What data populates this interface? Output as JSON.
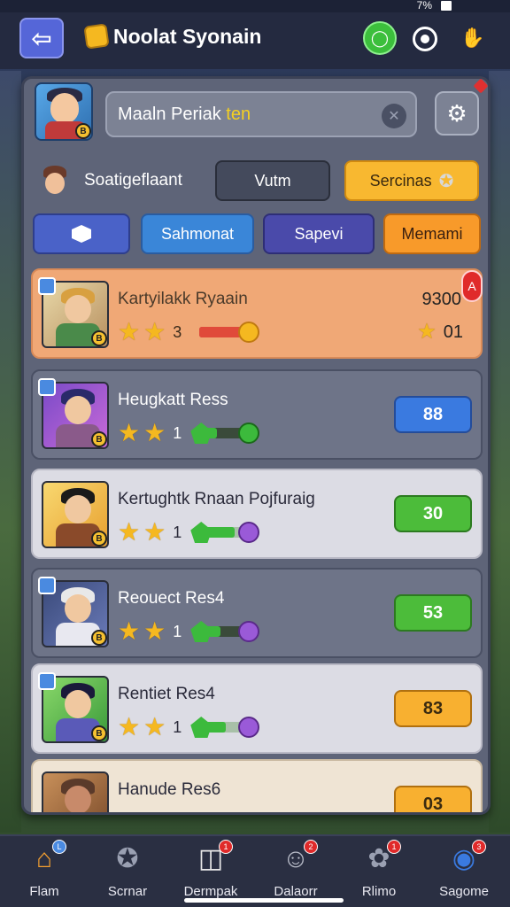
{
  "status_bar": {
    "battery_text": "7%"
  },
  "header": {
    "title": "Noolat Syonain",
    "back_icon": "back-arrow-icon",
    "chat_icon": "chat-icon",
    "record_icon": "record-icon",
    "hand_icon": "hand-icon"
  },
  "search": {
    "value_prefix": "Maaln Periak",
    "value_highlight": "ten",
    "clear_icon": "clear-icon"
  },
  "profile": {
    "name": "Soatigeflaant"
  },
  "buttons_row1": {
    "vutm": "Vutm",
    "sercinas": "Sercinas"
  },
  "filters": [
    {
      "label": "",
      "icon": "cube-icon"
    },
    {
      "label": "Sahmonat"
    },
    {
      "label": "Sapevi"
    },
    {
      "label": "Memami"
    }
  ],
  "rows": [
    {
      "name": "Kartyilakk Ryaain",
      "level": "3",
      "score": "9300",
      "score_star_value": "01",
      "variant": "highlight"
    },
    {
      "name": "Heugkatt Ress",
      "level": "1",
      "value": "88",
      "variant": "grey"
    },
    {
      "name": "Kertughtk Rnaan Pojfuraig",
      "level": "1",
      "value": "30",
      "variant": "light"
    },
    {
      "name": "Reouect Res4",
      "level": "1",
      "value": "53",
      "variant": "grey"
    },
    {
      "name": "Rentiet Res4",
      "level": "1",
      "value": "83",
      "variant": "light"
    },
    {
      "name": "Hanude Res6",
      "level": "",
      "value": "03",
      "variant": "cream"
    }
  ],
  "nav": [
    {
      "label": "Flam",
      "icon": "home-icon"
    },
    {
      "label": "Scrnar",
      "icon": "star-badge-icon"
    },
    {
      "label": "Dermpak",
      "icon": "cards-icon"
    },
    {
      "label": "Dalaorr",
      "icon": "face-icon"
    },
    {
      "label": "Rlimo",
      "icon": "gift-icon"
    },
    {
      "label": "Sagome",
      "icon": "globe-icon"
    }
  ],
  "colors": {
    "accent_orange": "#f8b830",
    "accent_green": "#4cbc3a",
    "accent_blue": "#3a7ae0",
    "panel": "#5e6478"
  }
}
